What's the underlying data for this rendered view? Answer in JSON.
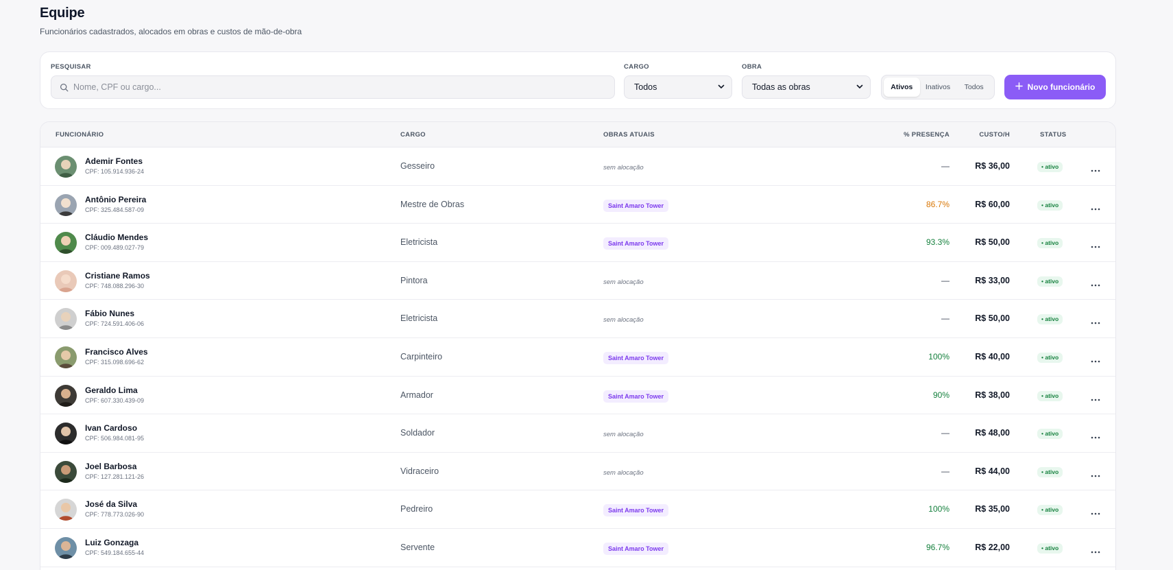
{
  "header": {
    "title": "Equipe",
    "subtitle": "Funcionários cadastrados, alocados em obras e custos de mão-de-obra"
  },
  "filters": {
    "search_label": "PESQUISAR",
    "search_placeholder": "Nome, CPF ou cargo...",
    "search_value": "",
    "cargo_label": "CARGO",
    "cargo_value": "Todos",
    "obra_label": "OBRA",
    "obra_value": "Todas as obras",
    "status_options": [
      "Ativos",
      "Inativos",
      "Todos"
    ],
    "status_selected": "Ativos",
    "new_button_label": "Novo funcionário"
  },
  "table": {
    "columns": {
      "funcionario": "FUNCIONÁRIO",
      "cargo": "CARGO",
      "obras": "OBRAS ATUAIS",
      "presenca": "% PRESENÇA",
      "custo": "CUSTO/H",
      "status": "STATUS"
    },
    "rows": [
      {
        "name": "Ademir Fontes",
        "cpf": "CPF: 105.914.936-24",
        "cargo": "Gesseiro",
        "obra": "sem alocação",
        "alocado": false,
        "presenca": "—",
        "custo": "R$ 36,00",
        "status": "• ativo"
      },
      {
        "name": "Antônio Pereira",
        "cpf": "CPF: 325.484.587-09",
        "cargo": "Mestre de Obras",
        "obra": "Saint Amaro Tower",
        "alocado": true,
        "presenca": "86.7%",
        "custo": "R$ 60,00",
        "status": "• ativo"
      },
      {
        "name": "Cláudio Mendes",
        "cpf": "CPF: 009.489.027-79",
        "cargo": "Eletricista",
        "obra": "Saint Amaro Tower",
        "alocado": true,
        "presenca": "93.3%",
        "custo": "R$ 50,00",
        "status": "• ativo"
      },
      {
        "name": "Cristiane Ramos",
        "cpf": "CPF: 748.088.296-30",
        "cargo": "Pintora",
        "obra": "sem alocação",
        "alocado": false,
        "presenca": "—",
        "custo": "R$ 33,00",
        "status": "• ativo"
      },
      {
        "name": "Fábio Nunes",
        "cpf": "CPF: 724.591.406-06",
        "cargo": "Eletricista",
        "obra": "sem alocação",
        "alocado": false,
        "presenca": "—",
        "custo": "R$ 50,00",
        "status": "• ativo"
      },
      {
        "name": "Francisco Alves",
        "cpf": "CPF: 315.098.696-62",
        "cargo": "Carpinteiro",
        "obra": "Saint Amaro Tower",
        "alocado": true,
        "presenca": "100%",
        "custo": "R$ 40,00",
        "status": "• ativo"
      },
      {
        "name": "Geraldo Lima",
        "cpf": "CPF: 607.330.439-09",
        "cargo": "Armador",
        "obra": "Saint Amaro Tower",
        "alocado": true,
        "presenca": "90%",
        "custo": "R$ 38,00",
        "status": "• ativo"
      },
      {
        "name": "Ivan Cardoso",
        "cpf": "CPF: 506.984.081-95",
        "cargo": "Soldador",
        "obra": "sem alocação",
        "alocado": false,
        "presenca": "—",
        "custo": "R$ 48,00",
        "status": "• ativo"
      },
      {
        "name": "Joel Barbosa",
        "cpf": "CPF: 127.281.121-26",
        "cargo": "Vidraceiro",
        "obra": "sem alocação",
        "alocado": false,
        "presenca": "—",
        "custo": "R$ 44,00",
        "status": "• ativo"
      },
      {
        "name": "José da Silva",
        "cpf": "CPF: 778.773.026-90",
        "cargo": "Pedreiro",
        "obra": "Saint Amaro Tower",
        "alocado": true,
        "presenca": "100%",
        "custo": "R$ 35,00",
        "status": "• ativo"
      },
      {
        "name": "Luiz Gonzaga",
        "cpf": "CPF: 549.184.655-44",
        "cargo": "Servente",
        "obra": "Saint Amaro Tower",
        "alocado": true,
        "presenca": "96.7%",
        "custo": "R$ 22,00",
        "status": "• ativo"
      }
    ]
  },
  "colors": {
    "accent": "#8b5cf6",
    "presence_warning": "#d97706",
    "presence_good": "#15803d",
    "presence_none": "#374151",
    "status_green": "#15803d"
  },
  "icons": {
    "search": "search-icon",
    "select_arrow": "chevron-down-icon",
    "add": "plus-icon",
    "row_menu": "more-horizontal-icon"
  }
}
